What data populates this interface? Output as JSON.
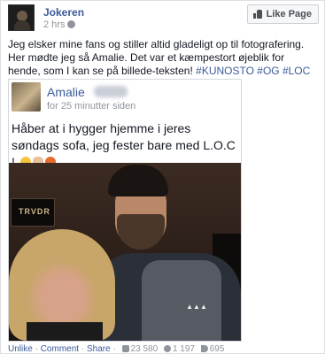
{
  "post": {
    "page_name": "Jokeren",
    "time": "2 hrs",
    "like_page_label": "Like Page",
    "text_main": "Jeg elsker mine fans og stiller altid gladeligt op til fotografering. Her mødte jeg så Amalie. Det var et kæmpestort øjeblik for hende, som I kan se på billede-teksten! ",
    "hashtags": "#KUNOSTO #OG #LOC"
  },
  "shared": {
    "name": "Amalie",
    "time": "for 25 minutter siden",
    "text": "Håber at i hygger hjemme i jeres søndags sofa, jeg fester bare med L.O.C ! ",
    "sign_text": "TRVDR"
  },
  "actions": {
    "unlike": "Unlike",
    "comment": "Comment",
    "share": "Share",
    "likes_count": "23 580",
    "comments_count": "1 197",
    "shares_count": "695"
  },
  "icons": {
    "globe": "globe-icon",
    "thumb": "thumbs-up-icon",
    "like_count": "like-count-icon",
    "comment_count": "comment-count-icon",
    "share_count": "share-count-icon"
  },
  "colors": {
    "link": "#3b5998",
    "meta": "#90949c"
  }
}
